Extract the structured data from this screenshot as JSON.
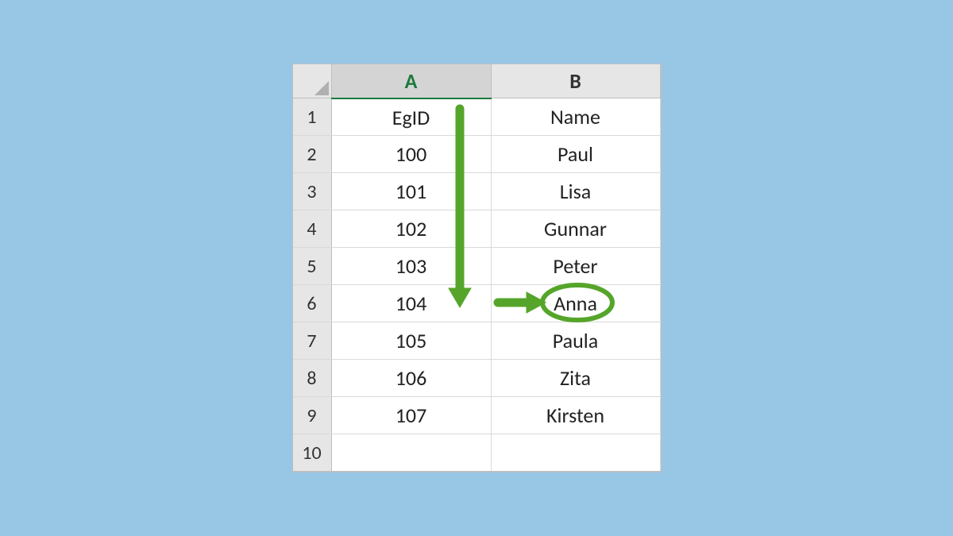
{
  "columns": {
    "A": "A",
    "B": "B"
  },
  "row_numbers": [
    "1",
    "2",
    "3",
    "4",
    "5",
    "6",
    "7",
    "8",
    "9",
    "10"
  ],
  "grid": [
    {
      "a": "EgID",
      "b": "Name"
    },
    {
      "a": "100",
      "b": "Paul"
    },
    {
      "a": "101",
      "b": "Lisa"
    },
    {
      "a": "102",
      "b": "Gunnar"
    },
    {
      "a": "103",
      "b": "Peter"
    },
    {
      "a": "104",
      "b": "Anna"
    },
    {
      "a": "105",
      "b": "Paula"
    },
    {
      "a": "106",
      "b": "Zita"
    },
    {
      "a": "107",
      "b": "Kirsten"
    },
    {
      "a": "",
      "b": ""
    }
  ],
  "selected_column": "A",
  "annotation": {
    "circled_value": "Anna",
    "circled_row": 6,
    "arrow_color": "#55a52a"
  }
}
